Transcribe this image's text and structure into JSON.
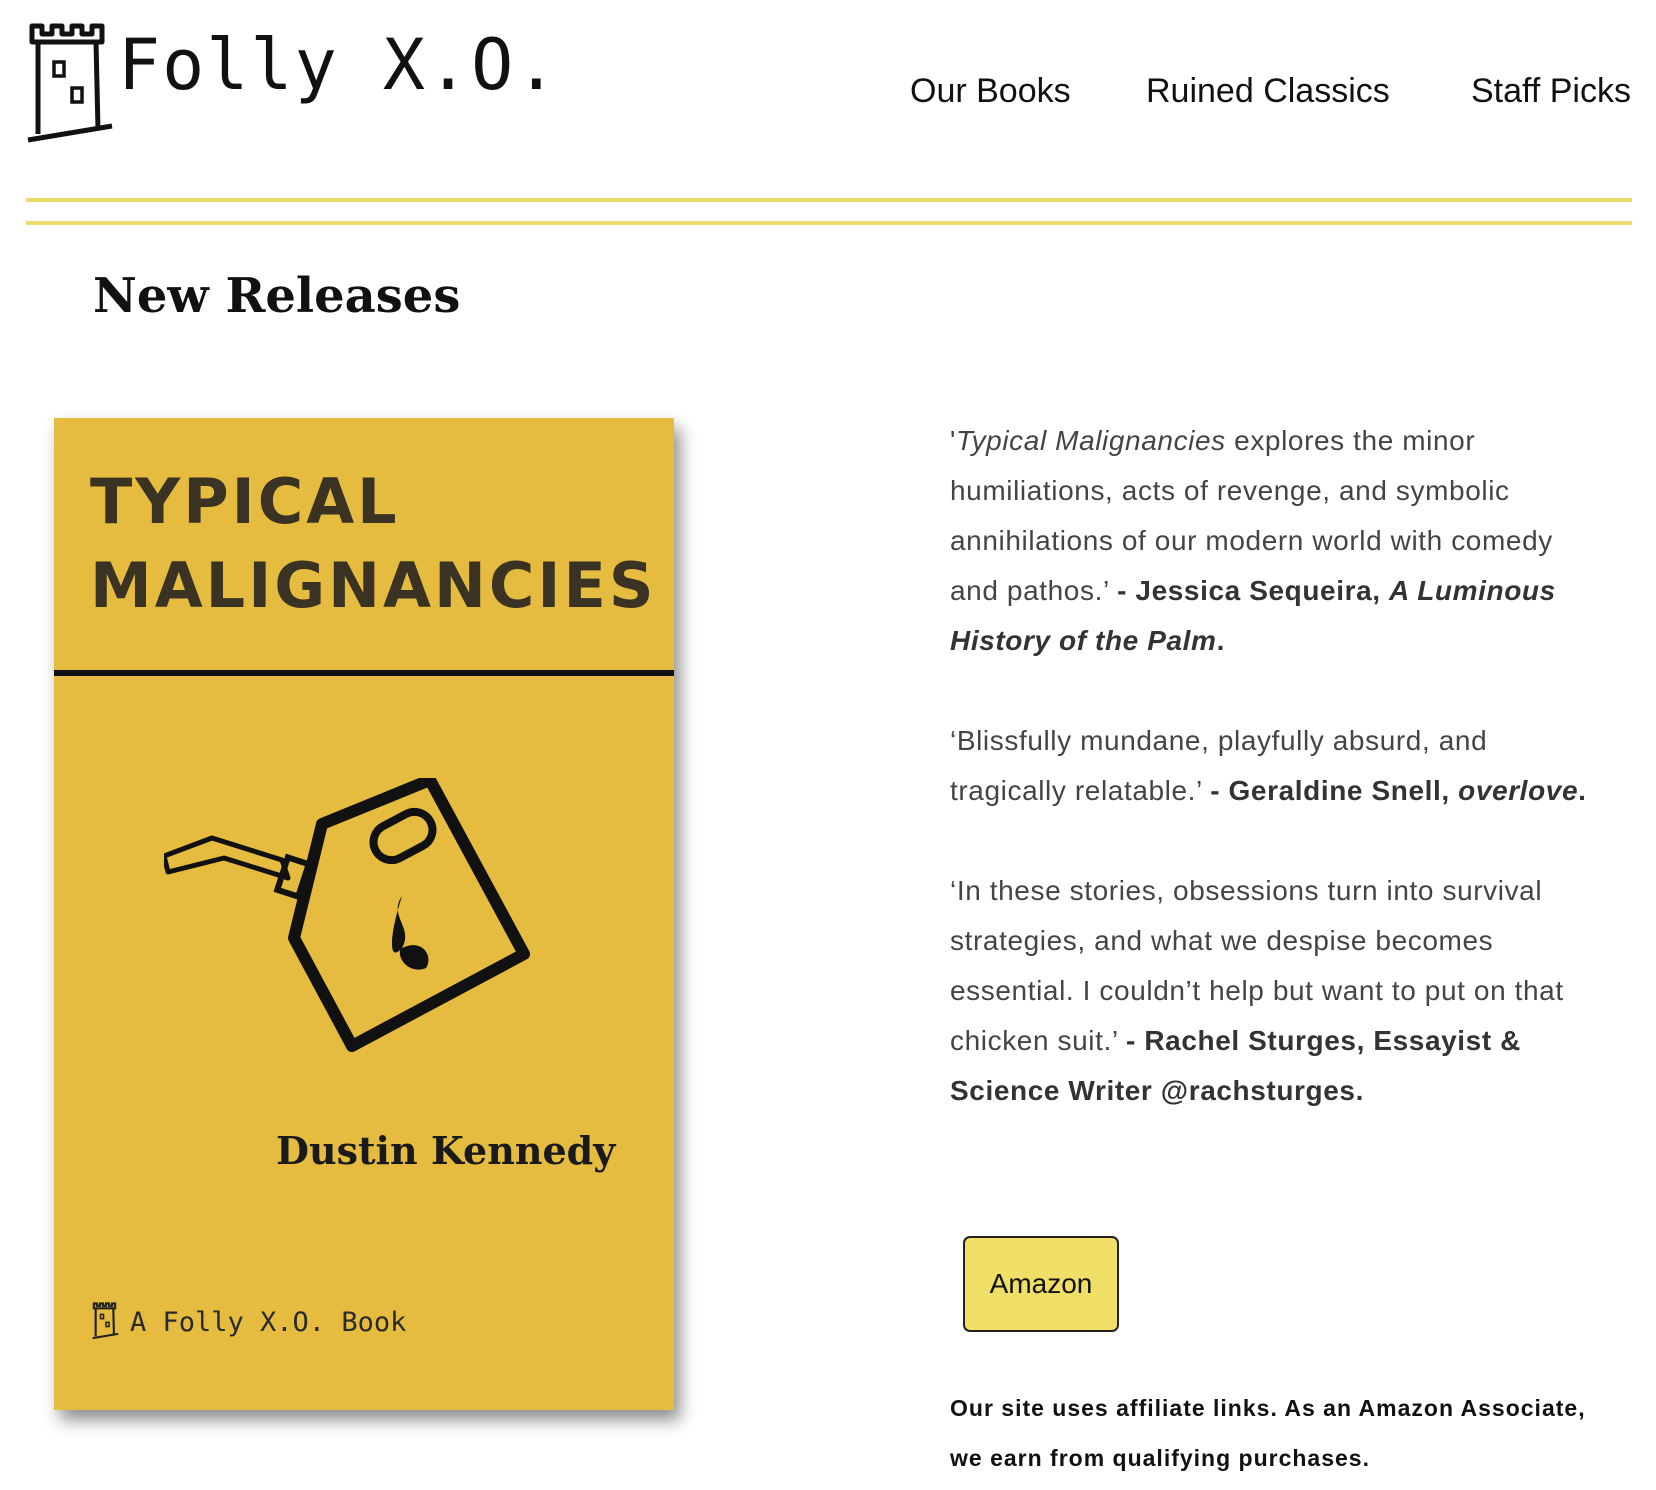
{
  "header": {
    "logo_icon": "castle-tower-icon",
    "brand": "Folly X.O.",
    "nav": [
      "Our Books",
      "Ruined Classics",
      "Staff Picks"
    ]
  },
  "main": {
    "heading": "New Releases",
    "book": {
      "cover_title_line1": "TYPICAL",
      "cover_title_line2": "MALIGNANCIES",
      "cover_art_icon": "gas-can-icon",
      "cover_author": "Dustin Kennedy",
      "cover_imprint": "A Folly X.O. Book",
      "cover_color": "#e5bc40"
    },
    "blurbs": [
      {
        "open": "'",
        "title": "Typical Malignancies",
        "text": " explores the minor humiliations, acts of revenge, and symbolic annihilations of our modern world with comedy and pathos.’ ",
        "attribution": "- Jessica Sequeira, ",
        "source": "A Luminous History of the Palm",
        "end": "."
      },
      {
        "text": "‘Blissfully mundane, playfully absurd, and tragically relatable.’ ",
        "attribution": "- Geraldine Snell, ",
        "source": "overlove",
        "end": "."
      },
      {
        "text": "‘In these stories, obsessions turn into survival strategies, and what we despise becomes essential. I couldn’t help but want to put on that chicken suit.’ ",
        "attribution": "- Rachel Sturges, Essayist & Science Writer @rachsturges."
      }
    ],
    "amazon_button": "Amazon",
    "disclaimer": "Our site uses affiliate links. As an Amazon Associate, we earn from qualifying purchases.",
    "accent_color": "#efdf66"
  }
}
